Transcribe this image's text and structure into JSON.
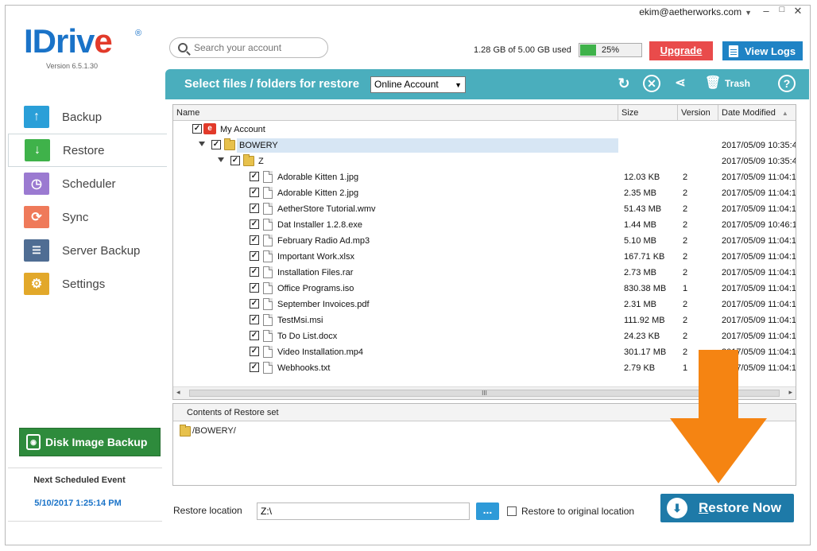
{
  "window": {
    "account_email": "ekim@aetherworks.com"
  },
  "logo": {
    "wordmark_blue": "IDriv",
    "wordmark_red": "e",
    "registered": "®",
    "version": "Version  6.5.1.30"
  },
  "sidebar": {
    "items": [
      {
        "label": "Backup",
        "icon": "arrow-up-icon",
        "color": "#2a9fd8"
      },
      {
        "label": "Restore",
        "icon": "arrow-down-icon",
        "color": "#3fb24a"
      },
      {
        "label": "Scheduler",
        "icon": "clock-icon",
        "color": "#9b7ad1"
      },
      {
        "label": "Sync",
        "icon": "sync-icon",
        "color": "#ef7a5a"
      },
      {
        "label": "Server Backup",
        "icon": "server-icon",
        "color": "#4f6d93"
      },
      {
        "label": "Settings",
        "icon": "gear-icon",
        "color": "#e2a82a"
      }
    ],
    "disk_image_label": "Disk Image Backup",
    "next_event_label": "Next Scheduled Event",
    "next_event_date": "5/10/2017 1:25:14 PM"
  },
  "search": {
    "placeholder": "Search your account"
  },
  "storage": {
    "usage_text": "1.28 GB of 5.00 GB used",
    "percent_label": "25%",
    "percent": 25
  },
  "toolbar": {
    "upgrade_label": "Upgrade",
    "view_logs_label": "View Logs"
  },
  "panel": {
    "title": "Select files / folders for restore",
    "source_selected": "Online Account",
    "trash_label": "Trash",
    "help_label": "?"
  },
  "table": {
    "headers": {
      "name": "Name",
      "size": "Size",
      "version": "Version",
      "date": "Date Modified"
    },
    "root": {
      "name": "My Account",
      "account_icon": "e"
    },
    "folder": {
      "name": "BOWERY",
      "date": "2017/05/09 10:35:4"
    },
    "subfolder": {
      "name": "Z",
      "date": "2017/05/09 10:35:4"
    },
    "scroll_thumb": "III",
    "files": [
      {
        "name": "Adorable Kitten 1.jpg",
        "size": "12.03 KB",
        "version": "2",
        "date": "2017/05/09 11:04:1"
      },
      {
        "name": "Adorable Kitten 2.jpg",
        "size": "2.35 MB",
        "version": "2",
        "date": "2017/05/09 11:04:1"
      },
      {
        "name": "AetherStore Tutorial.wmv",
        "size": "51.43 MB",
        "version": "2",
        "date": "2017/05/09 11:04:1"
      },
      {
        "name": "Dat Installer 1.2.8.exe",
        "size": "1.44 MB",
        "version": "2",
        "date": "2017/05/09 10:46:1"
      },
      {
        "name": "February Radio Ad.mp3",
        "size": "5.10 MB",
        "version": "2",
        "date": "2017/05/09 11:04:1"
      },
      {
        "name": "Important Work.xlsx",
        "size": "167.71 KB",
        "version": "2",
        "date": "2017/05/09 11:04:1"
      },
      {
        "name": "Installation Files.rar",
        "size": "2.73 MB",
        "version": "2",
        "date": "2017/05/09 11:04:1"
      },
      {
        "name": "Office Programs.iso",
        "size": "830.38 MB",
        "version": "1",
        "date": "2017/05/09 11:04:1"
      },
      {
        "name": "September Invoices.pdf",
        "size": "2.31 MB",
        "version": "2",
        "date": "2017/05/09 11:04:1"
      },
      {
        "name": "TestMsi.msi",
        "size": "111.92 MB",
        "version": "2",
        "date": "2017/05/09 11:04:1"
      },
      {
        "name": "To Do List.docx",
        "size": "24.23 KB",
        "version": "2",
        "date": "2017/05/09 11:04:1"
      },
      {
        "name": "Video Installation.mp4",
        "size": "301.17 MB",
        "version": "2",
        "date": "2017/05/09 11:04:1"
      },
      {
        "name": "Webhooks.txt",
        "size": "2.79 KB",
        "version": "1",
        "date": "2017/05/09 11:04:1"
      }
    ]
  },
  "restore_set": {
    "header": "Contents of Restore set",
    "items": [
      "/BOWERY/"
    ]
  },
  "bottom": {
    "location_label": "Restore location",
    "location_value": "Z:\\",
    "browse_label": "...",
    "original_label": "Restore to original location",
    "restore_now_label": "Restore Now"
  },
  "annotation": {
    "arrow_color": "#f58412"
  }
}
